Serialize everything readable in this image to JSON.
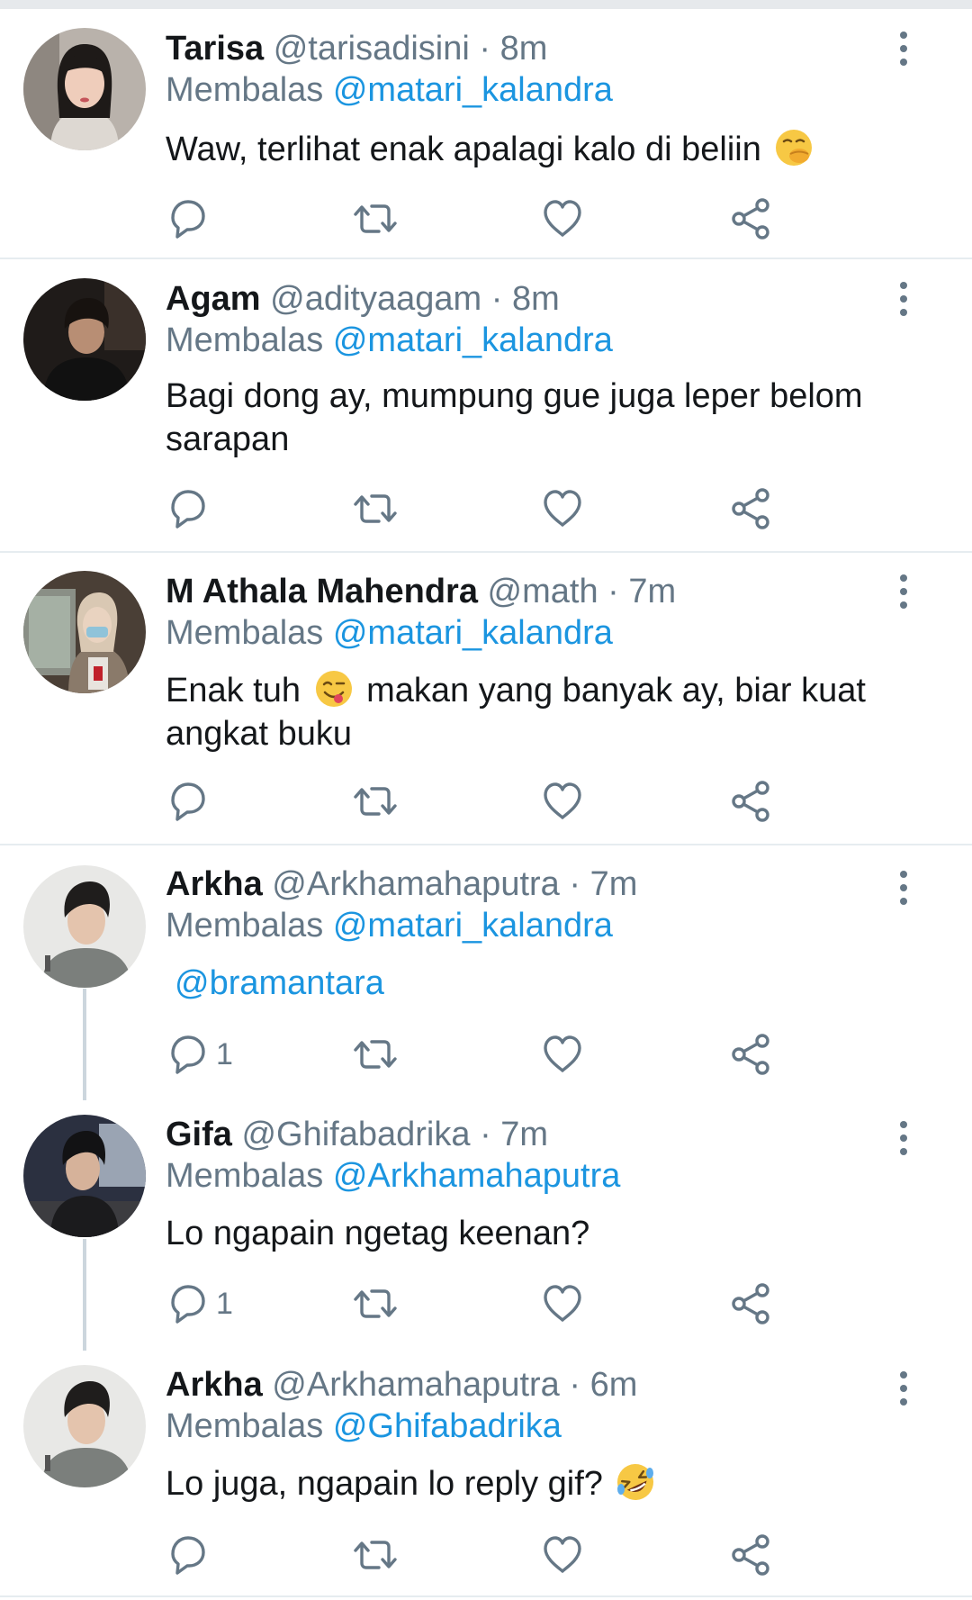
{
  "colors": {
    "link": "#1b95e0",
    "muted": "#657786",
    "text": "#14171a",
    "divider": "#e6ecf0"
  },
  "icons": [
    "more-vertical-icon",
    "reply-icon",
    "retweet-icon",
    "like-icon",
    "share-icon"
  ],
  "tweets": [
    {
      "name": "Tarisa",
      "handle": "@tarisadisini",
      "dot": "·",
      "time": "8m",
      "reply_prefix": "Membalas",
      "reply_to": "@matari_kalandra",
      "text_before_emoji": "Waw, terlihat enak apalagi kalo di beliin",
      "emoji": "face-with-hand-over-mouth",
      "reply_count": ""
    },
    {
      "name": "Agam",
      "handle": "@adityaagam",
      "dot": "·",
      "time": "8m",
      "reply_prefix": "Membalas",
      "reply_to": "@matari_kalandra",
      "text_line1": "Bagi dong ay, mumpung gue juga leper belom",
      "text_line2": "sarapan",
      "reply_count": ""
    },
    {
      "name": "M Athala Mahendra",
      "handle": "@math",
      "dot": "·",
      "time": "7m",
      "reply_prefix": "Membalas",
      "reply_to": "@matari_kalandra",
      "text_before_emoji": "Enak tuh",
      "emoji": "face-savoring-food",
      "text_after_emoji": "makan yang banyak ay, biar kuat",
      "text_line2": "angkat buku",
      "reply_count": ""
    },
    {
      "name": "Arkha",
      "handle": "@Arkhamahaputra",
      "dot": "·",
      "time": "7m",
      "reply_prefix": "Membalas",
      "reply_to": "@matari_kalandra",
      "mention_text": "@bramantara",
      "reply_count": "1"
    },
    {
      "name": "Gifa",
      "handle": "@Ghifabadrika",
      "dot": "·",
      "time": "7m",
      "reply_prefix": "Membalas",
      "reply_to": "@Arkhamahaputra",
      "text": "Lo ngapain ngetag keenan?",
      "reply_count": "1"
    },
    {
      "name": "Arkha",
      "handle": "@Arkhamahaputra",
      "dot": "·",
      "time": "6m",
      "reply_prefix": "Membalas",
      "reply_to": "@Ghifabadrika",
      "text_before_emoji": "Lo juga, ngapain lo reply gif?",
      "emoji": "rolling-on-the-floor-laughing",
      "reply_count": ""
    }
  ]
}
